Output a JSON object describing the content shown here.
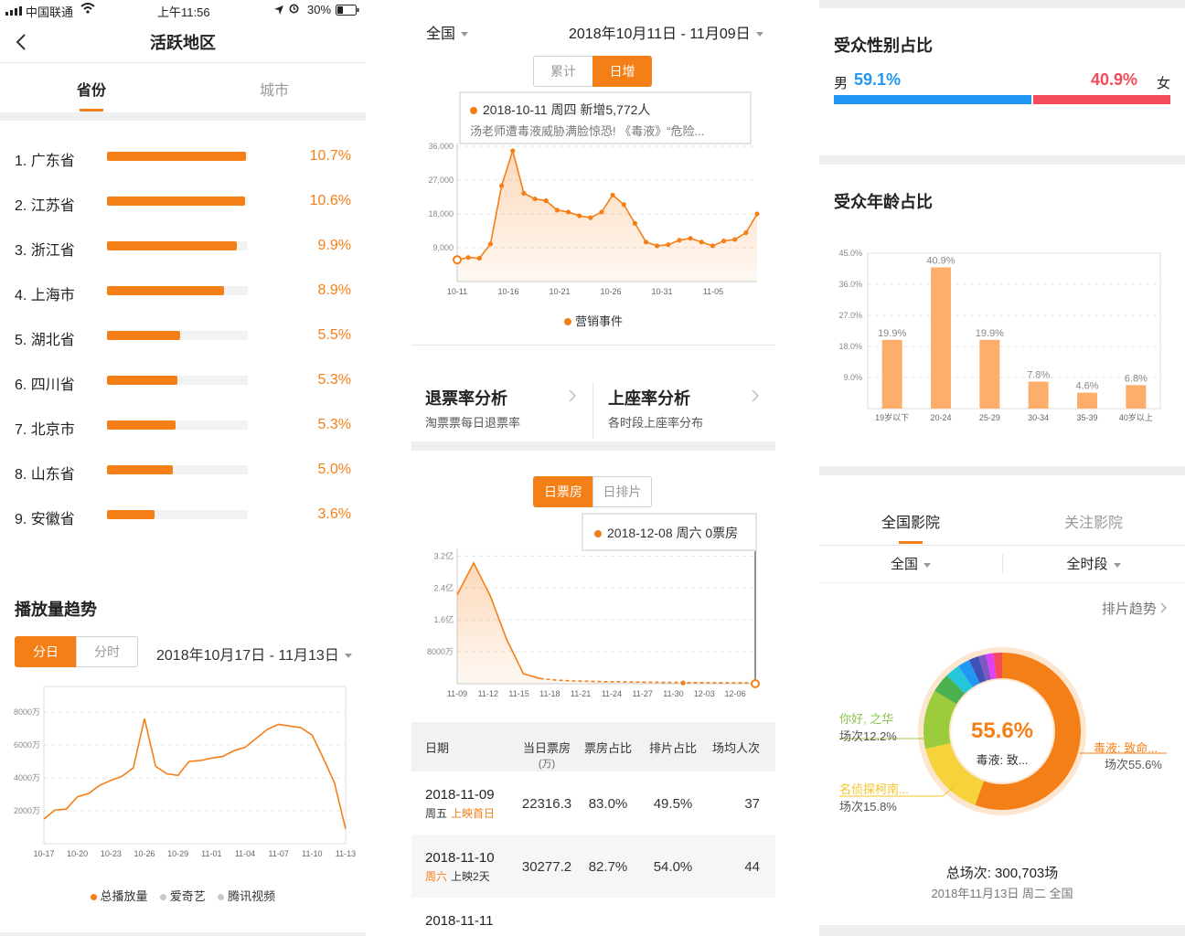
{
  "status_bar": {
    "carrier": "中国联通",
    "time": "上午11:56",
    "battery": "30%"
  },
  "nav": {
    "title": "活跃地区"
  },
  "region_tabs": [
    "省份",
    "城市"
  ],
  "provinces": [
    {
      "rank": "1. 广东省",
      "value": "10.7%",
      "share": 0.99
    },
    {
      "rank": "2. 江苏省",
      "value": "10.6%",
      "share": 0.98
    },
    {
      "rank": "3. 浙江省",
      "value": "9.9%",
      "share": 0.92
    },
    {
      "rank": "4. 上海市",
      "value": "8.9%",
      "share": 0.83
    },
    {
      "rank": "5. 湖北省",
      "value": "5.5%",
      "share": 0.52
    },
    {
      "rank": "6. 四川省",
      "value": "5.3%",
      "share": 0.5
    },
    {
      "rank": "7. 北京市",
      "value": "5.3%",
      "share": 0.49
    },
    {
      "rank": "8. 山东省",
      "value": "5.0%",
      "share": 0.47
    },
    {
      "rank": "9. 安徽省",
      "value": "3.6%",
      "share": 0.34
    }
  ],
  "play_trend": {
    "title": "播放量趋势",
    "toggle": [
      "分日",
      "分时"
    ],
    "date_range": "2018年10月17日 - 11月13日",
    "legend": [
      "总播放量",
      "爱奇艺",
      "腾讯视频"
    ],
    "colors": {
      "total": "#f57f17",
      "iqiyi": "#c8c8c8",
      "tencent": "#c8c8c8"
    }
  },
  "top_filter": {
    "region": "全国",
    "date_range": "2018年10月11日 - 11月09日"
  },
  "daily_toggle": [
    "累计",
    "日增"
  ],
  "daily_tooltip": {
    "line1": "2018-10-11 周四 新增5,772人",
    "line2": "汤老师遭毒液威胁满脸惊恐! 《毒液》“危险..."
  },
  "daily_legend": "营销事件",
  "analysis_cards": [
    {
      "title": "退票率分析",
      "subtitle": "淘票票每日退票率"
    },
    {
      "title": "上座率分析",
      "subtitle": "各时段上座率分布"
    }
  ],
  "box_toggle": [
    "日票房",
    "日排片"
  ],
  "box_tooltip": "2018-12-08 周六 0票房",
  "table": {
    "headers": [
      "日期",
      "当日票房",
      "(万)",
      "票房占比",
      "排片占比",
      "场均人次"
    ],
    "rows": [
      {
        "date": "2018-11-09",
        "weekday": "周五",
        "tag": "上映首日",
        "box": "22316.3",
        "box_share": "83.0%",
        "screen_share": "49.5%",
        "avg": "37"
      },
      {
        "date": "2018-11-10",
        "weekday": "周六",
        "tag": "上映2天",
        "box": "30277.2",
        "box_share": "82.7%",
        "screen_share": "54.0%",
        "avg": "44"
      },
      {
        "date": "2018-11-11",
        "weekday": "",
        "tag": "",
        "box": "",
        "box_share": "",
        "screen_share": "",
        "avg": ""
      }
    ]
  },
  "gender": {
    "title": "受众性别占比",
    "male_label": "男",
    "male_value": "59.1%",
    "female_value": "40.9%",
    "female_label": "女",
    "male_share": 0.591,
    "colors": {
      "male": "#2196f3",
      "female": "#f44a5a"
    }
  },
  "age": {
    "title": "受众年龄占比"
  },
  "cinema_tabs": [
    "全国影院",
    "关注影院"
  ],
  "cinema_filters": [
    "全国",
    "全时段"
  ],
  "schedule_trend": "排片趋势",
  "donut": {
    "center_value": "55.6%",
    "center_label": "毒液: 致...",
    "labels": [
      {
        "name": "你好, 之华",
        "value": "场次12.2%",
        "color": "#8bc34a"
      },
      {
        "name": "名侦探柯南...",
        "value": "场次15.8%",
        "color": "#f6c324"
      },
      {
        "name": "毒液: 致命...",
        "value": "场次55.6%",
        "color": "#f57f17"
      }
    ],
    "total": "总场次: 300,703场",
    "date": "2018年11月13日 周二 全国"
  },
  "chart_data": [
    {
      "type": "line",
      "title": "播放量趋势",
      "x_ticks": [
        "10-17",
        "10-20",
        "10-23",
        "10-26",
        "10-29",
        "11-01",
        "11-04",
        "11-07",
        "11-10",
        "11-13"
      ],
      "y_ticks": [
        "2000万",
        "4000万",
        "6000万",
        "8000万"
      ],
      "ylim": [
        0,
        9000
      ],
      "series": [
        {
          "name": "总播放量",
          "values": [
            1500,
            2050,
            2100,
            2850,
            3050,
            3550,
            3850,
            4100,
            4600,
            7600,
            4700,
            4250,
            4150,
            5000,
            5050,
            5200,
            5300,
            5650,
            5850,
            6400,
            6950,
            7250,
            7150,
            7050,
            6600,
            5200,
            3700,
            900
          ]
        }
      ]
    },
    {
      "type": "area",
      "x_ticks": [
        "10-11",
        "10-16",
        "10-21",
        "10-26",
        "10-31",
        "11-05"
      ],
      "y_ticks": [
        "9,000",
        "18,000",
        "27,000",
        "36,000"
      ],
      "ylim": [
        0,
        36000
      ],
      "series": [
        {
          "name": "日增",
          "values": [
            5772,
            6400,
            6200,
            10000,
            25500,
            34800,
            23500,
            22000,
            21500,
            19000,
            18500,
            17500,
            17000,
            18500,
            23000,
            20500,
            15500,
            10500,
            9500,
            9800,
            11000,
            11500,
            10500,
            9500,
            10800,
            11200,
            13000,
            18000
          ]
        }
      ]
    },
    {
      "type": "area",
      "x_ticks": [
        "11-09",
        "11-12",
        "11-15",
        "11-18",
        "11-21",
        "11-24",
        "11-27",
        "11-30",
        "12-03",
        "12-06"
      ],
      "y_ticks": [
        "8000万",
        "1.6亿",
        "2.4亿",
        "3.2亿"
      ],
      "ylim": [
        0,
        33000
      ],
      "series": [
        {
          "name": "日票房",
          "values": [
            22316,
            30277,
            22000,
            11000,
            2500,
            1300,
            900,
            700,
            600,
            500,
            450,
            400,
            350,
            300,
            280,
            260,
            240,
            220,
            200
          ]
        }
      ]
    },
    {
      "type": "bar",
      "title": "受众年龄占比",
      "categories": [
        "19岁以下",
        "20-24",
        "25-29",
        "30-34",
        "35-39",
        "40岁以上"
      ],
      "values": [
        19.9,
        40.9,
        19.9,
        7.8,
        4.6,
        6.8
      ],
      "value_labels": [
        "19.9%",
        "40.9%",
        "19.9%",
        "7.8%",
        "4.6%",
        "6.8%"
      ],
      "y_ticks": [
        "9.0%",
        "18.0%",
        "27.0%",
        "36.0%",
        "45.0%"
      ],
      "ylim": [
        0,
        45
      ]
    },
    {
      "type": "pie",
      "labels": [
        "毒液: 致命...",
        "名侦探柯南...",
        "你好, 之华"
      ],
      "values": [
        55.6,
        15.8,
        12.2,
        4.0,
        3.0,
        2.5,
        2.0,
        1.6,
        1.5,
        1.8
      ],
      "colors": [
        "#f57f17",
        "#f6d33a",
        "#9ccc3c",
        "#4caf50",
        "#26c6da",
        "#2196f3",
        "#3f51b5",
        "#7e57c2",
        "#e040fb",
        "#f44a5a"
      ]
    }
  ]
}
